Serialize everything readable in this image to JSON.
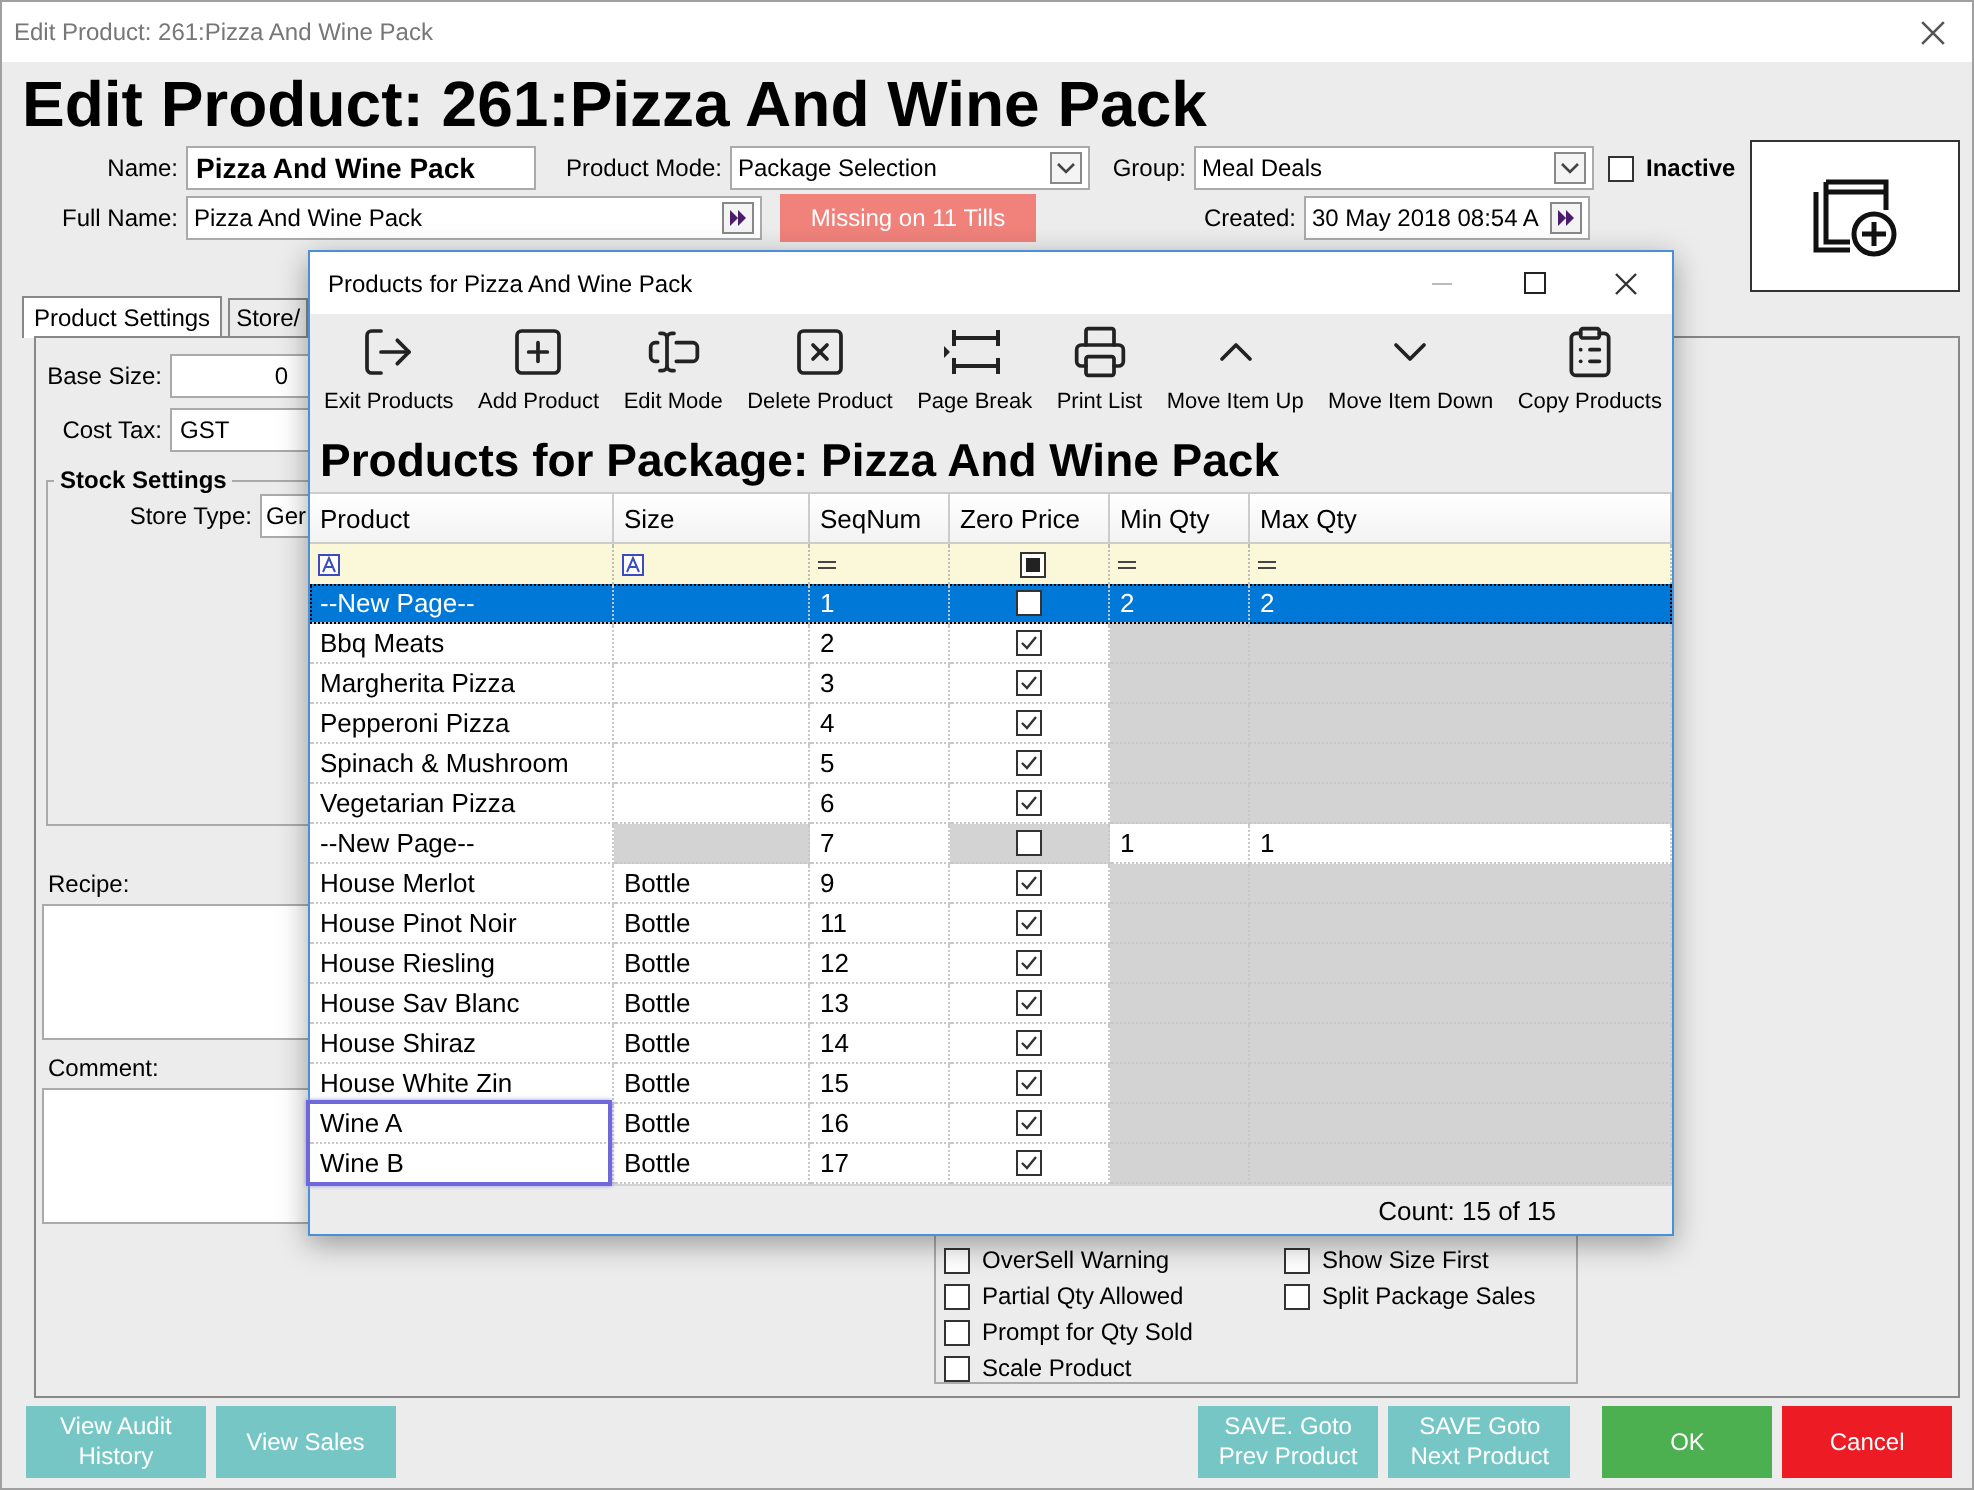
{
  "window": {
    "title": "Edit Product: 261:Pizza And Wine Pack"
  },
  "heading": "Edit Product: 261:Pizza And Wine Pack",
  "form": {
    "name_label": "Name:",
    "name": "Pizza And Wine Pack",
    "product_mode_label": "Product Mode:",
    "product_mode": "Package Selection",
    "group_label": "Group:",
    "group": "Meal Deals",
    "inactive": {
      "label": "Inactive",
      "checked": false
    },
    "full_name_label": "Full Name:",
    "full_name": "Pizza And Wine Pack",
    "missing_button": "Missing on 11 Tills",
    "created_label": "Created:",
    "created": "30 May 2018 08:54 A"
  },
  "tabs": [
    {
      "label": "Product Settings",
      "selected": true
    },
    {
      "label": "Store/",
      "selected": false
    }
  ],
  "settings": {
    "base_size_label": "Base Size:",
    "base_size": "0",
    "cost_tax_label": "Cost Tax:",
    "cost_tax": "GST",
    "stock_settings_title": "Stock Settings",
    "store_type_label": "Store Type:",
    "store_type": "Ger",
    "recipe_label": "Recipe:",
    "comment_label": "Comment:"
  },
  "options_left": [
    {
      "label": "OverSell Warning",
      "checked": false
    },
    {
      "label": "Partial Qty Allowed",
      "checked": false
    },
    {
      "label": "Prompt for Qty Sold",
      "checked": false
    },
    {
      "label": "Scale Product",
      "checked": false
    }
  ],
  "options_right": [
    {
      "label": "Show Size First",
      "checked": false
    },
    {
      "label": "Split Package Sales",
      "checked": false
    }
  ],
  "footer": {
    "left_buttons": [
      {
        "label": "View Audit History",
        "kind": "secondary"
      },
      {
        "label": "View Sales",
        "kind": "secondary"
      }
    ],
    "right_buttons": [
      {
        "label": "SAVE. Goto Prev Product",
        "kind": "secondary"
      },
      {
        "label": "SAVE Goto Next Product",
        "kind": "secondary"
      },
      {
        "label": "OK",
        "kind": "ok"
      },
      {
        "label": "Cancel",
        "kind": "cancel"
      }
    ]
  },
  "dialog": {
    "title": "Products for Pizza And Wine Pack",
    "toolbar": [
      {
        "label": "Exit Products",
        "kind": "exit"
      },
      {
        "label": "Add Product",
        "kind": "add"
      },
      {
        "label": "Edit Mode",
        "kind": "edit"
      },
      {
        "label": "Delete Product",
        "kind": "delete"
      },
      {
        "label": "Page Break",
        "kind": "page_break"
      },
      {
        "label": "Print List",
        "kind": "print"
      },
      {
        "label": "Move Item Up",
        "kind": "up"
      },
      {
        "label": "Move Item Down",
        "kind": "down"
      },
      {
        "label": "Copy Products",
        "kind": "copy"
      }
    ],
    "heading": "Products for Package: Pizza And Wine Pack",
    "table": {
      "columns": [
        "Product",
        "Size",
        "SeqNum",
        "Zero Price",
        "Min Qty",
        "Max Qty"
      ],
      "zero_price_filter_indeterminate": true,
      "rows": [
        {
          "kind": "page",
          "product": "--New Page--",
          "seq": "1",
          "zero_price": false,
          "min_qty": "2",
          "max_qty": "2",
          "selected": true,
          "highlighted": false
        },
        {
          "kind": "item",
          "product": "Bbq Meats",
          "seq": "2",
          "zero_price": true,
          "selected": false,
          "highlighted": false
        },
        {
          "kind": "item",
          "product": "Margherita Pizza",
          "seq": "3",
          "zero_price": true,
          "selected": false,
          "highlighted": false
        },
        {
          "kind": "item",
          "product": "Pepperoni Pizza",
          "seq": "4",
          "zero_price": true,
          "selected": false,
          "highlighted": false
        },
        {
          "kind": "item",
          "product": "Spinach & Mushroom",
          "seq": "5",
          "zero_price": true,
          "selected": false,
          "highlighted": false
        },
        {
          "kind": "item",
          "product": "Vegetarian Pizza",
          "seq": "6",
          "zero_price": true,
          "selected": false,
          "highlighted": false
        },
        {
          "kind": "page",
          "product": "--New Page--",
          "seq": "7",
          "zero_price": false,
          "min_qty": "1",
          "max_qty": "1",
          "selected": false,
          "highlighted": false
        },
        {
          "kind": "item",
          "product": "House Merlot",
          "size": "Bottle",
          "seq": "9",
          "zero_price": true,
          "selected": false,
          "highlighted": false
        },
        {
          "kind": "item",
          "product": "House Pinot Noir",
          "size": "Bottle",
          "seq": "11",
          "zero_price": true,
          "selected": false,
          "highlighted": false
        },
        {
          "kind": "item",
          "product": "House Riesling",
          "size": "Bottle",
          "seq": "12",
          "zero_price": true,
          "selected": false,
          "highlighted": false
        },
        {
          "kind": "item",
          "product": "House Sav Blanc",
          "size": "Bottle",
          "seq": "13",
          "zero_price": true,
          "selected": false,
          "highlighted": false
        },
        {
          "kind": "item",
          "product": "House Shiraz",
          "size": "Bottle",
          "seq": "14",
          "zero_price": true,
          "selected": false,
          "highlighted": false
        },
        {
          "kind": "item",
          "product": "House White Zin",
          "size": "Bottle",
          "seq": "15",
          "zero_price": true,
          "selected": false,
          "highlighted": false
        },
        {
          "kind": "item",
          "product": "Wine A",
          "size": "Bottle",
          "seq": "16",
          "zero_price": true,
          "selected": false,
          "highlighted": true
        },
        {
          "kind": "item",
          "product": "Wine B",
          "size": "Bottle",
          "seq": "17",
          "zero_price": true,
          "selected": false,
          "highlighted": true
        }
      ]
    },
    "count": "Count: 15 of 15"
  }
}
